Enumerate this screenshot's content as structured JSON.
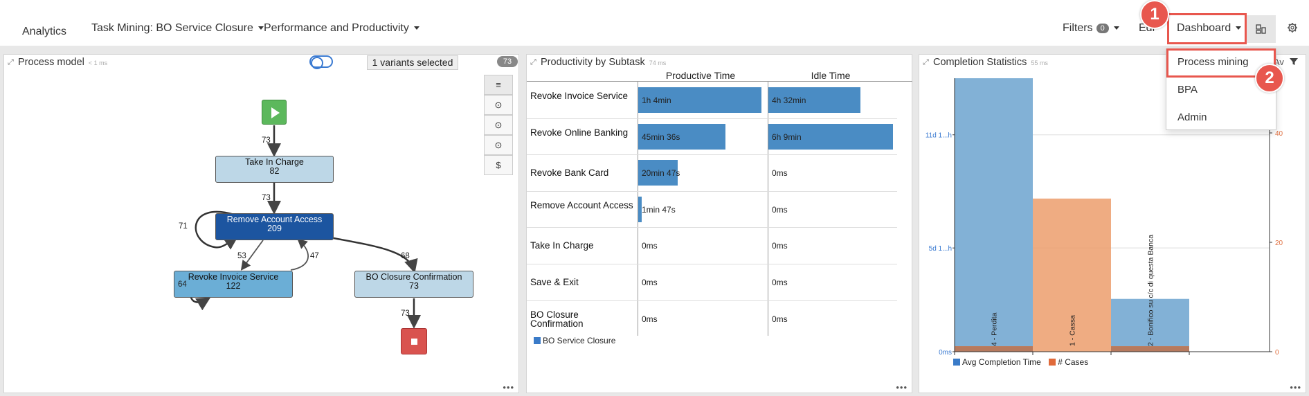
{
  "topnav": {
    "brand": "Analytics",
    "tabs": [
      {
        "label": "Task Mining: BO Service Closure"
      },
      {
        "label": "Performance and Productivity"
      }
    ],
    "filters_label": "Filters",
    "filters_count": "0",
    "edit_label": "Edi",
    "dashboard_label": "Dashboard",
    "icons": [
      "layout-icon",
      "gear-icon"
    ]
  },
  "dashboard_menu": {
    "items": [
      {
        "label": "Process mining"
      },
      {
        "label": "BPA"
      },
      {
        "label": "Admin"
      }
    ]
  },
  "annotations": {
    "step1": "1",
    "step2": "2",
    "highlight_color": "#e8574e"
  },
  "process_model": {
    "title": "Process model",
    "ms": "< 1 ms",
    "variants_label": "1 variants selected",
    "count_badge": "73",
    "toolbar_icons": [
      "menu-icon",
      "clock-icon",
      "clock-max-icon",
      "clock-min-icon",
      "dollar-icon"
    ],
    "toolbar_glyphs": [
      "≡",
      "⊙",
      "⊙",
      "⊙",
      "$"
    ],
    "nodes": [
      {
        "name": "Take In Charge",
        "count": "82"
      },
      {
        "name": "Remove Account Access",
        "count": "209"
      },
      {
        "name": "Revoke Invoice Service",
        "count": "122"
      },
      {
        "name": "BO Closure Confirmation",
        "count": "73"
      }
    ],
    "edge_labels": [
      "73",
      "73",
      "71",
      "53",
      "47",
      "68",
      "64",
      "73"
    ]
  },
  "productivity": {
    "title": "Productivity by Subtask",
    "ms": "74 ms",
    "columns": [
      "Productive Time",
      "Idle Time"
    ],
    "rows": [
      {
        "label": "Revoke Invoice Service",
        "productive": "1h 4min",
        "idle": "4h 32min",
        "p_frac": 1.0,
        "i_frac": 0.74
      },
      {
        "label": "Revoke Online Banking",
        "productive": "45min 36s",
        "idle": "6h 9min",
        "p_frac": 0.71,
        "i_frac": 1.0
      },
      {
        "label": "Revoke Bank Card",
        "productive": "20min 47s",
        "idle": "0ms",
        "p_frac": 0.32,
        "i_frac": 0
      },
      {
        "label": "Remove Account Access",
        "productive": "1min 47s",
        "idle": "0ms",
        "p_frac": 0.03,
        "i_frac": 0
      },
      {
        "label": "Take In Charge",
        "productive": "0ms",
        "idle": "0ms",
        "p_frac": 0,
        "i_frac": 0
      },
      {
        "label": "Save & Exit",
        "productive": "0ms",
        "idle": "0ms",
        "p_frac": 0,
        "i_frac": 0
      },
      {
        "label": "BO Closure Confirmation",
        "productive": "0ms",
        "idle": "0ms",
        "p_frac": 0,
        "i_frac": 0
      }
    ],
    "legend": "BO Service Closure",
    "legend_color": "#3a7bc8"
  },
  "completion": {
    "title": "Completion Statistics",
    "ms": "55 ms",
    "title_suffix": "Av",
    "legend": [
      "Avg Completion Time",
      "# Cases"
    ],
    "colors": {
      "avg": "#82b1d6",
      "cases": "#ec9d6c",
      "overlap": "#b77a5e",
      "avg_legend": "#3a7bc8",
      "cases_legend": "#e06a3a"
    }
  },
  "chart_data": {
    "type": "bar",
    "categories": [
      "4 - Perdita",
      "1 - Cassa",
      "2 - Bonifico su c/c di questa Banca"
    ],
    "series": [
      {
        "name": "Avg Completion Time",
        "values": [
          14.5,
          0,
          2.8
        ],
        "units": "days"
      },
      {
        "name": "# Cases",
        "values": [
          1,
          28,
          1
        ]
      }
    ],
    "y_left_ticks": [
      "0ms",
      "5d 1...h",
      "11d 1...h"
    ],
    "y_right_ticks": [
      "0",
      "20",
      "40"
    ],
    "left_axis_color": "#3a7ad1",
    "right_axis_color": "#e07040"
  }
}
